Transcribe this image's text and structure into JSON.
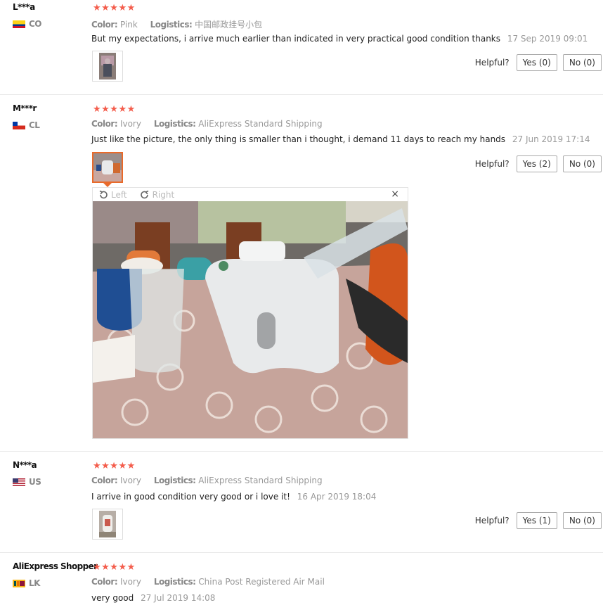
{
  "labels": {
    "color": "Color:",
    "logistics": "Logistics:",
    "helpful": "Helpful?",
    "left": "Left",
    "right": "Right",
    "close": "×"
  },
  "stars": "★★★★★",
  "reviews": [
    {
      "user": "L***a",
      "country": "CO",
      "color_value": "Pink",
      "logistics_value": "中国邮政挂号小包",
      "text": "But my expectations, i arrive much earlier than indicated in very practical good condition thanks",
      "date": "17 Sep 2019 09:01",
      "yes": "Yes (0)",
      "no": "No (0)"
    },
    {
      "user": "M***r",
      "country": "CL",
      "color_value": "Ivory",
      "logistics_value": "AliExpress Standard Shipping",
      "text": "Just like the picture, the only thing is smaller than i thought, i demand 11 days to reach my hands",
      "date": "27 Jun 2019 17:14",
      "yes": "Yes (2)",
      "no": "No (0)"
    },
    {
      "user": "N***a",
      "country": "US",
      "color_value": "Ivory",
      "logistics_value": "AliExpress Standard Shipping",
      "text": "I arrive in good condition very good or i love it!",
      "date": "16 Apr 2019 18:04",
      "yes": "Yes (1)",
      "no": "No (0)"
    },
    {
      "user": "AliExpress Shopper",
      "country": "LK",
      "color_value": "Ivory",
      "logistics_value": "China Post Registered Air Mail",
      "text": "very good",
      "date": "27 Jul 2019 14:08"
    }
  ]
}
